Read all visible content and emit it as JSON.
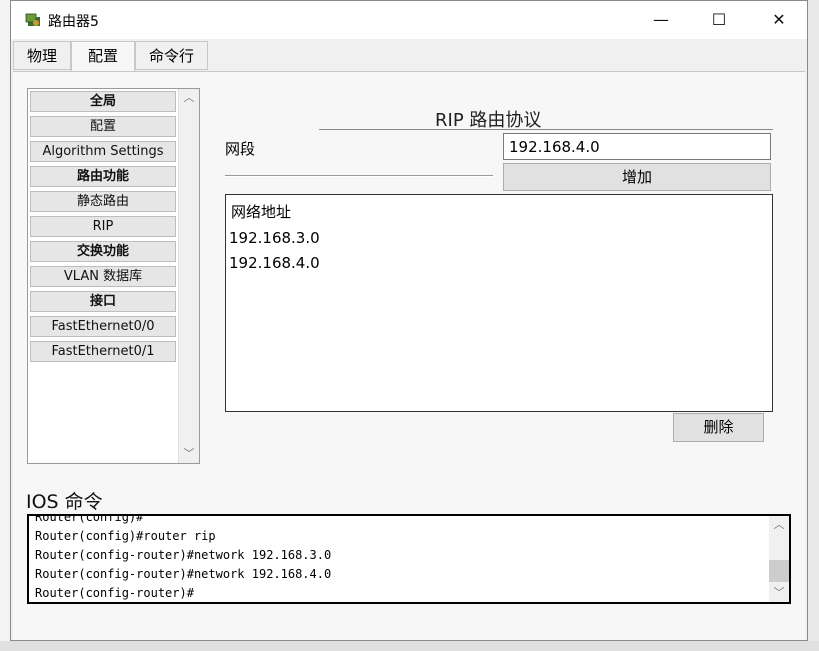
{
  "window": {
    "title": "路由器5"
  },
  "titlebar": {
    "minimize": "—",
    "maximize": "☐",
    "close": "✕"
  },
  "tabs": [
    "物理",
    "配置",
    "命令行"
  ],
  "sidebar": {
    "items": [
      {
        "label": "全局",
        "bold": true
      },
      {
        "label": "配置",
        "bold": false
      },
      {
        "label": "Algorithm Settings",
        "bold": false
      },
      {
        "label": "路由功能",
        "bold": true
      },
      {
        "label": "静态路由",
        "bold": false
      },
      {
        "label": "RIP",
        "bold": false
      },
      {
        "label": "交换功能",
        "bold": true
      },
      {
        "label": "VLAN 数据库",
        "bold": false
      },
      {
        "label": "接口",
        "bold": true
      },
      {
        "label": "FastEthernet0/0",
        "bold": false
      },
      {
        "label": "FastEthernet0/1",
        "bold": false
      }
    ]
  },
  "rip": {
    "title": "RIP 路由协议",
    "network_label": "网段",
    "network_value": "192.168.4.0",
    "add_button": "增加",
    "list_header": "网络地址",
    "networks": [
      "192.168.3.0",
      "192.168.4.0"
    ],
    "delete_button": "删除"
  },
  "ios": {
    "label": "IOS 命令",
    "lines": [
      "Router(config)#",
      "Router(config)#router rip",
      "Router(config-router)#network 192.168.3.0",
      "Router(config-router)#network 192.168.4.0",
      "Router(config-router)#"
    ]
  }
}
